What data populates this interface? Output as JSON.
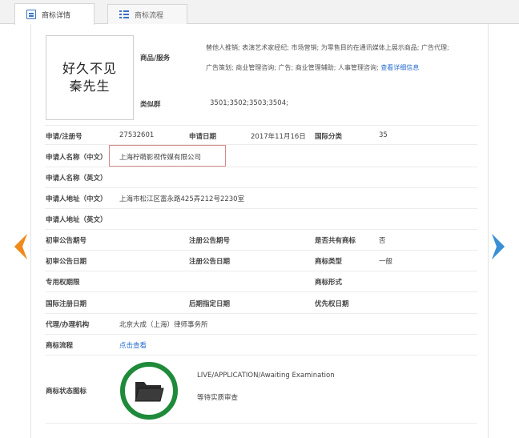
{
  "tabs": [
    {
      "label": "商标详情",
      "icon": "document-icon",
      "active": true
    },
    {
      "label": "商标流程",
      "icon": "list-icon",
      "active": false
    }
  ],
  "brand": {
    "line1": "好久不见",
    "line2": "秦先生"
  },
  "goods_services": {
    "label": "商品/服务",
    "line1": "替他人推销; 表演艺术家经纪; 市场营销; 为零售目的在通讯媒体上展示商品; 广告代理;",
    "line2": "广告策划; 商业管理咨询; 广告; 商业管理辅助; 人事管理咨询;",
    "more_link": "查看详细信息"
  },
  "similar_groups": {
    "label": "类似群",
    "value": "3501;3502;3503;3504;"
  },
  "row_reg": {
    "reg_no_label": "申请/注册号",
    "reg_no": "27532601",
    "date_label": "申请日期",
    "date": "2017年11月16日",
    "class_label": "国际分类",
    "class_value": "35"
  },
  "applicant_cn": {
    "label": "申请人名称（中文）",
    "value": "上海柠萌影视传媒有限公司"
  },
  "applicant_en": {
    "label": "申请人名称（英文）",
    "value": ""
  },
  "address_cn": {
    "label": "申请人地址（中文）",
    "value": "上海市松江区富永路425弄212号2230室"
  },
  "address_en": {
    "label": "申请人地址（英文）",
    "value": ""
  },
  "row_pub1": {
    "a_label": "初审公告期号",
    "b_label": "注册公告期号",
    "c_label": "是否共有商标",
    "c_value": "否"
  },
  "row_pub2": {
    "a_label": "初审公告日期",
    "b_label": "注册公告日期",
    "c_label": "商标类型",
    "c_value": "一般"
  },
  "row_excl": {
    "a_label": "专用权期限",
    "c_label": "商标形式"
  },
  "row_intl": {
    "a_label": "国际注册日期",
    "b_label": "后期指定日期",
    "c_label": "优先权日期"
  },
  "agent": {
    "label": "代理/办理机构",
    "value": "北京大成（上海）律师事务所"
  },
  "process": {
    "label": "商标流程",
    "link": "点击查看"
  },
  "status": {
    "label": "商标状态图标",
    "en": "LIVE/APPLICATION/Awaiting Examination",
    "cn": "等待实质审查"
  },
  "colors": {
    "accent_blue": "#2a6ecf",
    "arrow_left": "#f08a1c",
    "arrow_right": "#3a8fd6",
    "status_green": "#1e8a3a"
  }
}
